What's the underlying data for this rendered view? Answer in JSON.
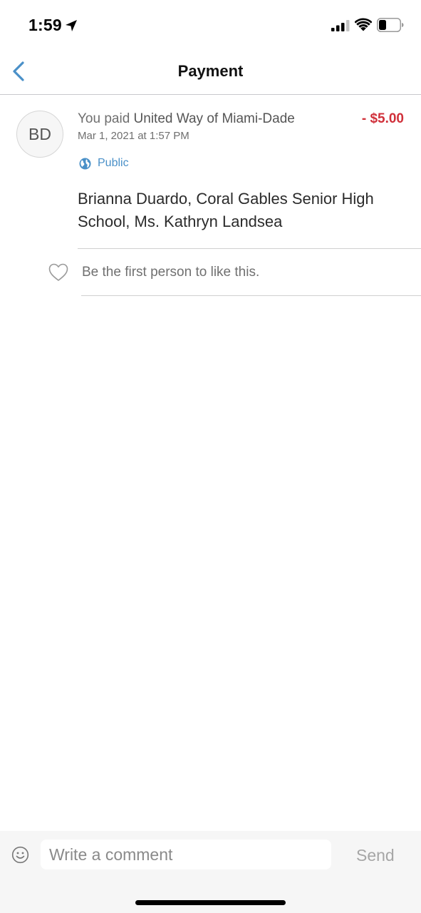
{
  "status_bar": {
    "time": "1:59",
    "icons": [
      "location-arrow-icon",
      "cellular-signal-icon",
      "wifi-icon",
      "battery-icon"
    ]
  },
  "nav": {
    "title": "Payment",
    "back_icon": "chevron-left-icon",
    "accent_color": "#4a90c8"
  },
  "payment": {
    "avatar_initials": "BD",
    "prefix": "You paid ",
    "payee": "United Way of Miami-Dade",
    "amount": "- $5.00",
    "amount_color": "#d0303a",
    "date": "Mar 1, 2021 at 1:57 PM",
    "audience": "Public",
    "audience_icon": "globe-icon",
    "note": "Brianna Duardo, Coral Gables Senior High School, Ms. Kathryn Landsea"
  },
  "likes": {
    "text": "Be the first person to like this.",
    "icon": "heart-icon"
  },
  "comment": {
    "placeholder": "Write a comment",
    "send_label": "Send",
    "emoji_icon": "smiley-icon"
  }
}
